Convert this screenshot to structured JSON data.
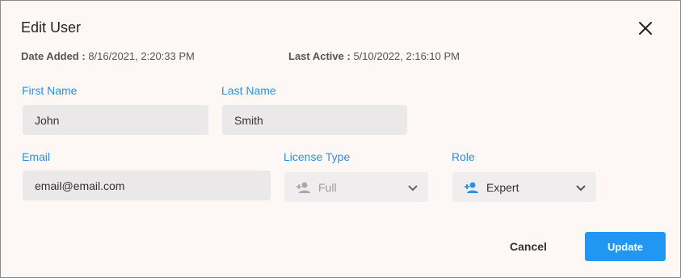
{
  "dialog": {
    "title": "Edit User",
    "date_added_label": "Date Added :",
    "date_added_value": "8/16/2021, 2:20:33 PM",
    "last_active_label": "Last Active :",
    "last_active_value": "5/10/2022, 2:16:10 PM"
  },
  "form": {
    "first_name": {
      "label": "First Name",
      "value": "John"
    },
    "last_name": {
      "label": "Last Name",
      "value": "Smith"
    },
    "email": {
      "label": "Email",
      "value": "email@email.com"
    },
    "license_type": {
      "label": "License Type",
      "value": "Full",
      "disabled": true,
      "icon": "person-add-icon"
    },
    "role": {
      "label": "Role",
      "value": "Expert",
      "icon": "person-add-icon"
    }
  },
  "actions": {
    "cancel_label": "Cancel",
    "update_label": "Update"
  },
  "colors": {
    "accent": "#2196f3",
    "label": "#2e8fe0",
    "background": "#fdf8f5",
    "field": "#eae8e8"
  }
}
